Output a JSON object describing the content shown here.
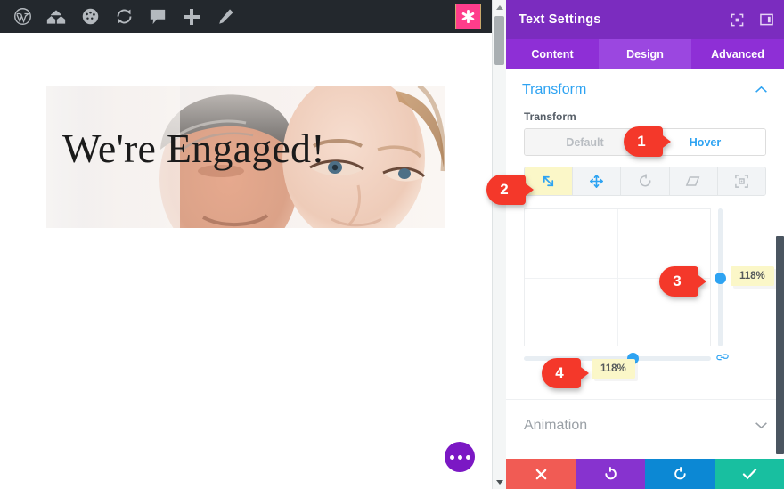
{
  "wp_adminbar": {
    "items": [
      {
        "name": "wordpress-logo-icon",
        "label": "W"
      },
      {
        "name": "site-home-icon",
        "label": "Home"
      },
      {
        "name": "dashboard-gauge-icon",
        "label": "Dashboard"
      },
      {
        "name": "updates-refresh-icon",
        "label": "Updates"
      },
      {
        "name": "comments-bubble-icon",
        "label": "Comments"
      },
      {
        "name": "new-content-plus-icon",
        "label": "New"
      },
      {
        "name": "edit-pencil-icon",
        "label": "Edit"
      }
    ],
    "right_badge": {
      "name": "divi-asterisk-icon",
      "label": "*",
      "color": "#ff3d8b"
    }
  },
  "canvas": {
    "hero_title": "We're Engaged!",
    "fab": {
      "name": "page-settings-button",
      "label": "•••"
    }
  },
  "panel": {
    "header": {
      "title": "Text Settings",
      "icons": [
        {
          "name": "focus-target-icon",
          "label": "Focus"
        },
        {
          "name": "panel-layout-icon",
          "label": "Layout"
        }
      ]
    },
    "tabs": [
      {
        "label": "Content",
        "active": false
      },
      {
        "label": "Design",
        "active": true
      },
      {
        "label": "Advanced",
        "active": false
      }
    ],
    "sections": {
      "transform": {
        "title": "Transform",
        "collapsed": false,
        "field_label": "Transform",
        "state_toggle": {
          "options": [
            "Default",
            "Hover"
          ],
          "selected": "Hover"
        },
        "modes": [
          {
            "name": "scale-icon",
            "label": "Scale",
            "active": true
          },
          {
            "name": "translate-move-icon",
            "label": "Translate",
            "active": false
          },
          {
            "name": "rotate-icon",
            "label": "Rotate",
            "active": false
          },
          {
            "name": "skew-icon",
            "label": "Skew",
            "active": false
          },
          {
            "name": "transform-origin-icon",
            "label": "Transform Origin",
            "active": false
          }
        ],
        "values": {
          "vertical_scale": "118%",
          "horizontal_scale": "118%"
        },
        "link_toggle": {
          "name": "link-axes-icon",
          "label": "Link"
        }
      },
      "animation": {
        "title": "Animation",
        "collapsed": true
      }
    },
    "footer": [
      {
        "name": "discard-button",
        "label": "✕",
        "color": "#f15b54"
      },
      {
        "name": "undo-button",
        "label": "↺",
        "color": "#8733cf"
      },
      {
        "name": "redo-button",
        "label": "↻",
        "color": "#0c88d4"
      },
      {
        "name": "save-button",
        "label": "✔",
        "color": "#18bfa0"
      }
    ]
  },
  "callouts": [
    {
      "num": "1",
      "target": "hover-toggle"
    },
    {
      "num": "2",
      "target": "scale-mode-icon"
    },
    {
      "num": "3",
      "target": "vertical-scale-slider"
    },
    {
      "num": "4",
      "target": "horizontal-scale-slider"
    }
  ]
}
